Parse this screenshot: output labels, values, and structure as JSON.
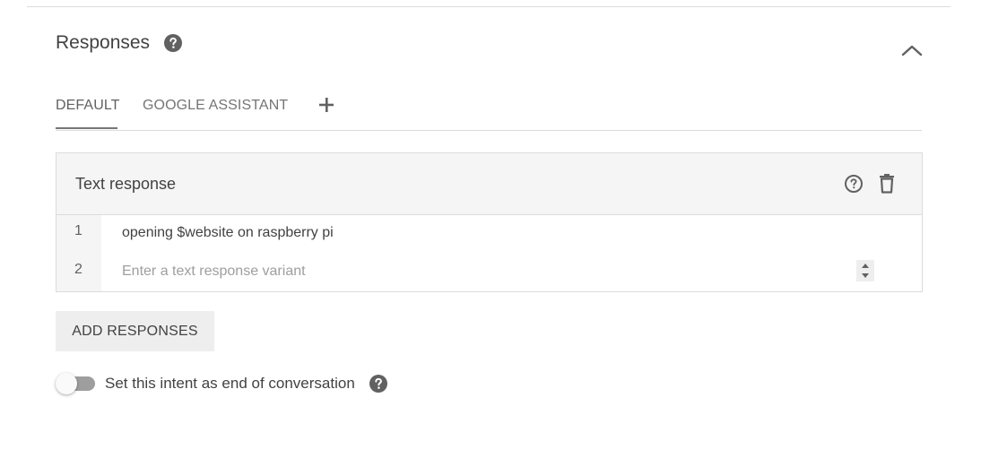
{
  "section": {
    "title": "Responses",
    "help_icon": "help-circle-icon",
    "collapse_icon": "chevron-up-icon"
  },
  "tabs": [
    {
      "label": "DEFAULT",
      "active": true
    },
    {
      "label": "GOOGLE ASSISTANT",
      "active": false
    }
  ],
  "tab_add_icon": "plus-icon",
  "card": {
    "title": "Text response",
    "help_icon": "help-outline-icon",
    "delete_icon": "trash-icon",
    "rows": [
      {
        "number": "1",
        "text": "opening $website on raspberry pi"
      },
      {
        "number": "2",
        "text": ""
      }
    ],
    "input_placeholder": "Enter a text response variant"
  },
  "add_button": {
    "label": "ADD RESPONSES"
  },
  "end_conversation": {
    "label": "Set this intent as end of conversation",
    "enabled": false,
    "help_icon": "help-circle-icon"
  },
  "colors": {
    "icon_gray": "#616161",
    "header_bg": "#f5f5f5",
    "button_bg": "#eeeeee"
  }
}
